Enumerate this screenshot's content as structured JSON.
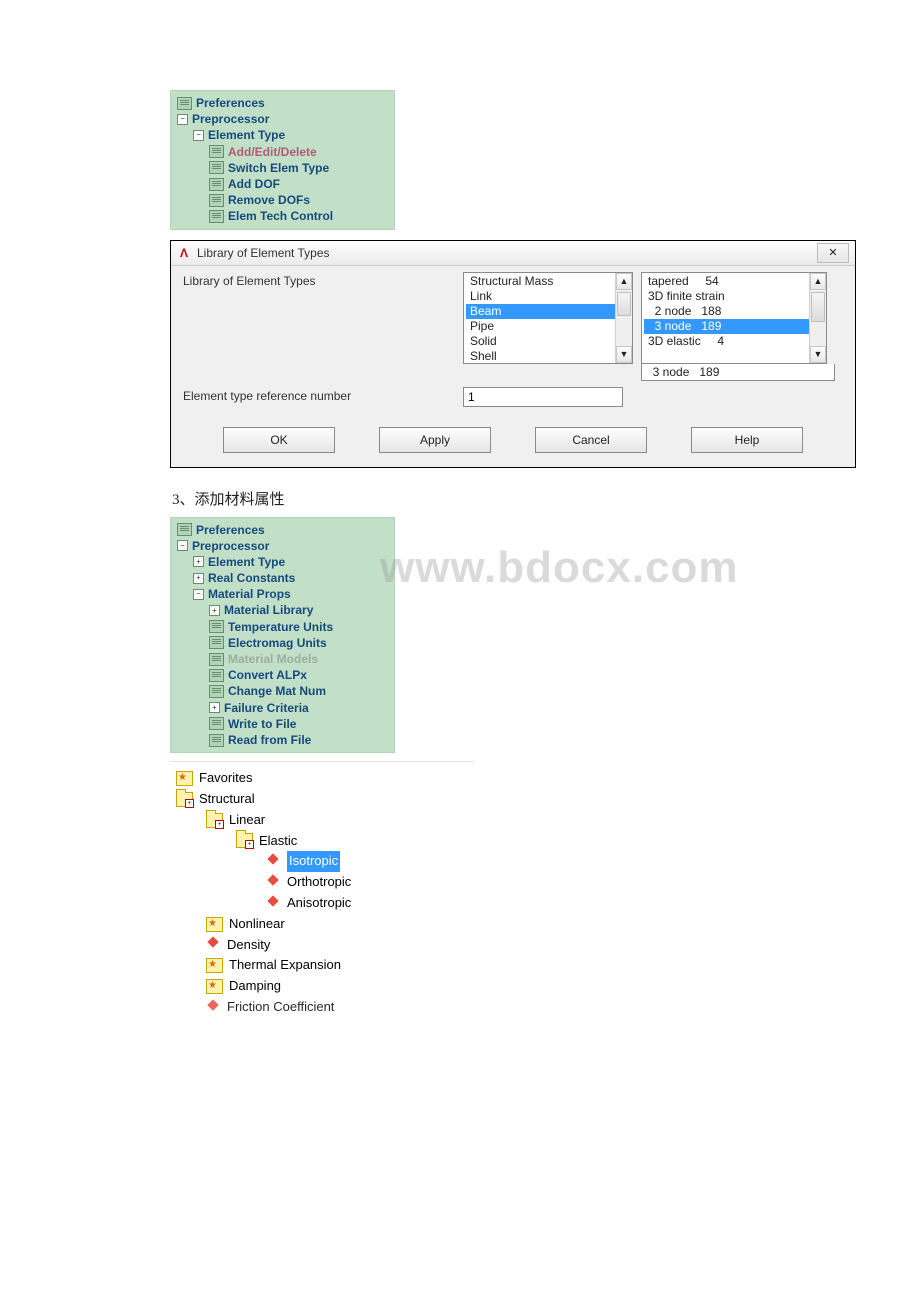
{
  "tree1": {
    "preferences": "Preferences",
    "preprocessor": "Preprocessor",
    "element_type": "Element Type",
    "items": [
      {
        "label": "Add/Edit/Delete",
        "selected": true
      },
      {
        "label": "Switch Elem Type"
      },
      {
        "label": "Add DOF"
      },
      {
        "label": "Remove DOFs"
      },
      {
        "label": "Elem Tech Control"
      }
    ]
  },
  "dialog": {
    "title": "Library of Element Types",
    "close": "✕",
    "lib_label": "Library of Element Types",
    "left_list": [
      "Structural Mass",
      "Link",
      "Beam",
      "Pipe",
      "Solid",
      "Shell"
    ],
    "left_selected": "Beam",
    "right_list": [
      "tapered     54",
      "3D finite strain",
      "  2 node   188",
      "  3 node   189",
      "3D elastic     4"
    ],
    "right_selected": "  3 node   189",
    "right_extra_row": "  3 node   189",
    "ref_label": "Element type reference number",
    "ref_value": "1",
    "buttons": {
      "ok": "OK",
      "apply": "Apply",
      "cancel": "Cancel",
      "help": "Help"
    }
  },
  "section_text": "3、添加材料属性",
  "watermark": "www.bdocx.com",
  "tree2": {
    "preferences": "Preferences",
    "preprocessor": "Preprocessor",
    "element_type": "Element Type",
    "real_constants": "Real Constants",
    "material_props": "Material Props",
    "items": [
      {
        "label": "Material Library",
        "type": "expand"
      },
      {
        "label": "Temperature Units",
        "type": "leaf"
      },
      {
        "label": "Electromag Units",
        "type": "leaf"
      },
      {
        "label": "Material Models",
        "type": "leaf",
        "selected": true
      },
      {
        "label": "Convert ALPx",
        "type": "leaf"
      },
      {
        "label": "Change Mat Num",
        "type": "leaf"
      },
      {
        "label": "Failure Criteria",
        "type": "expand"
      },
      {
        "label": "Write to File",
        "type": "leaf"
      },
      {
        "label": "Read from File",
        "type": "leaf"
      }
    ]
  },
  "mat_tree": {
    "favorites": "Favorites",
    "structural": "Structural",
    "linear": "Linear",
    "elastic": "Elastic",
    "isotropic": "Isotropic",
    "orthotropic": "Orthotropic",
    "anisotropic": "Anisotropic",
    "nonlinear": "Nonlinear",
    "density": "Density",
    "thermal": "Thermal Expansion",
    "damping": "Damping",
    "friction": "Friction Coefficient"
  }
}
